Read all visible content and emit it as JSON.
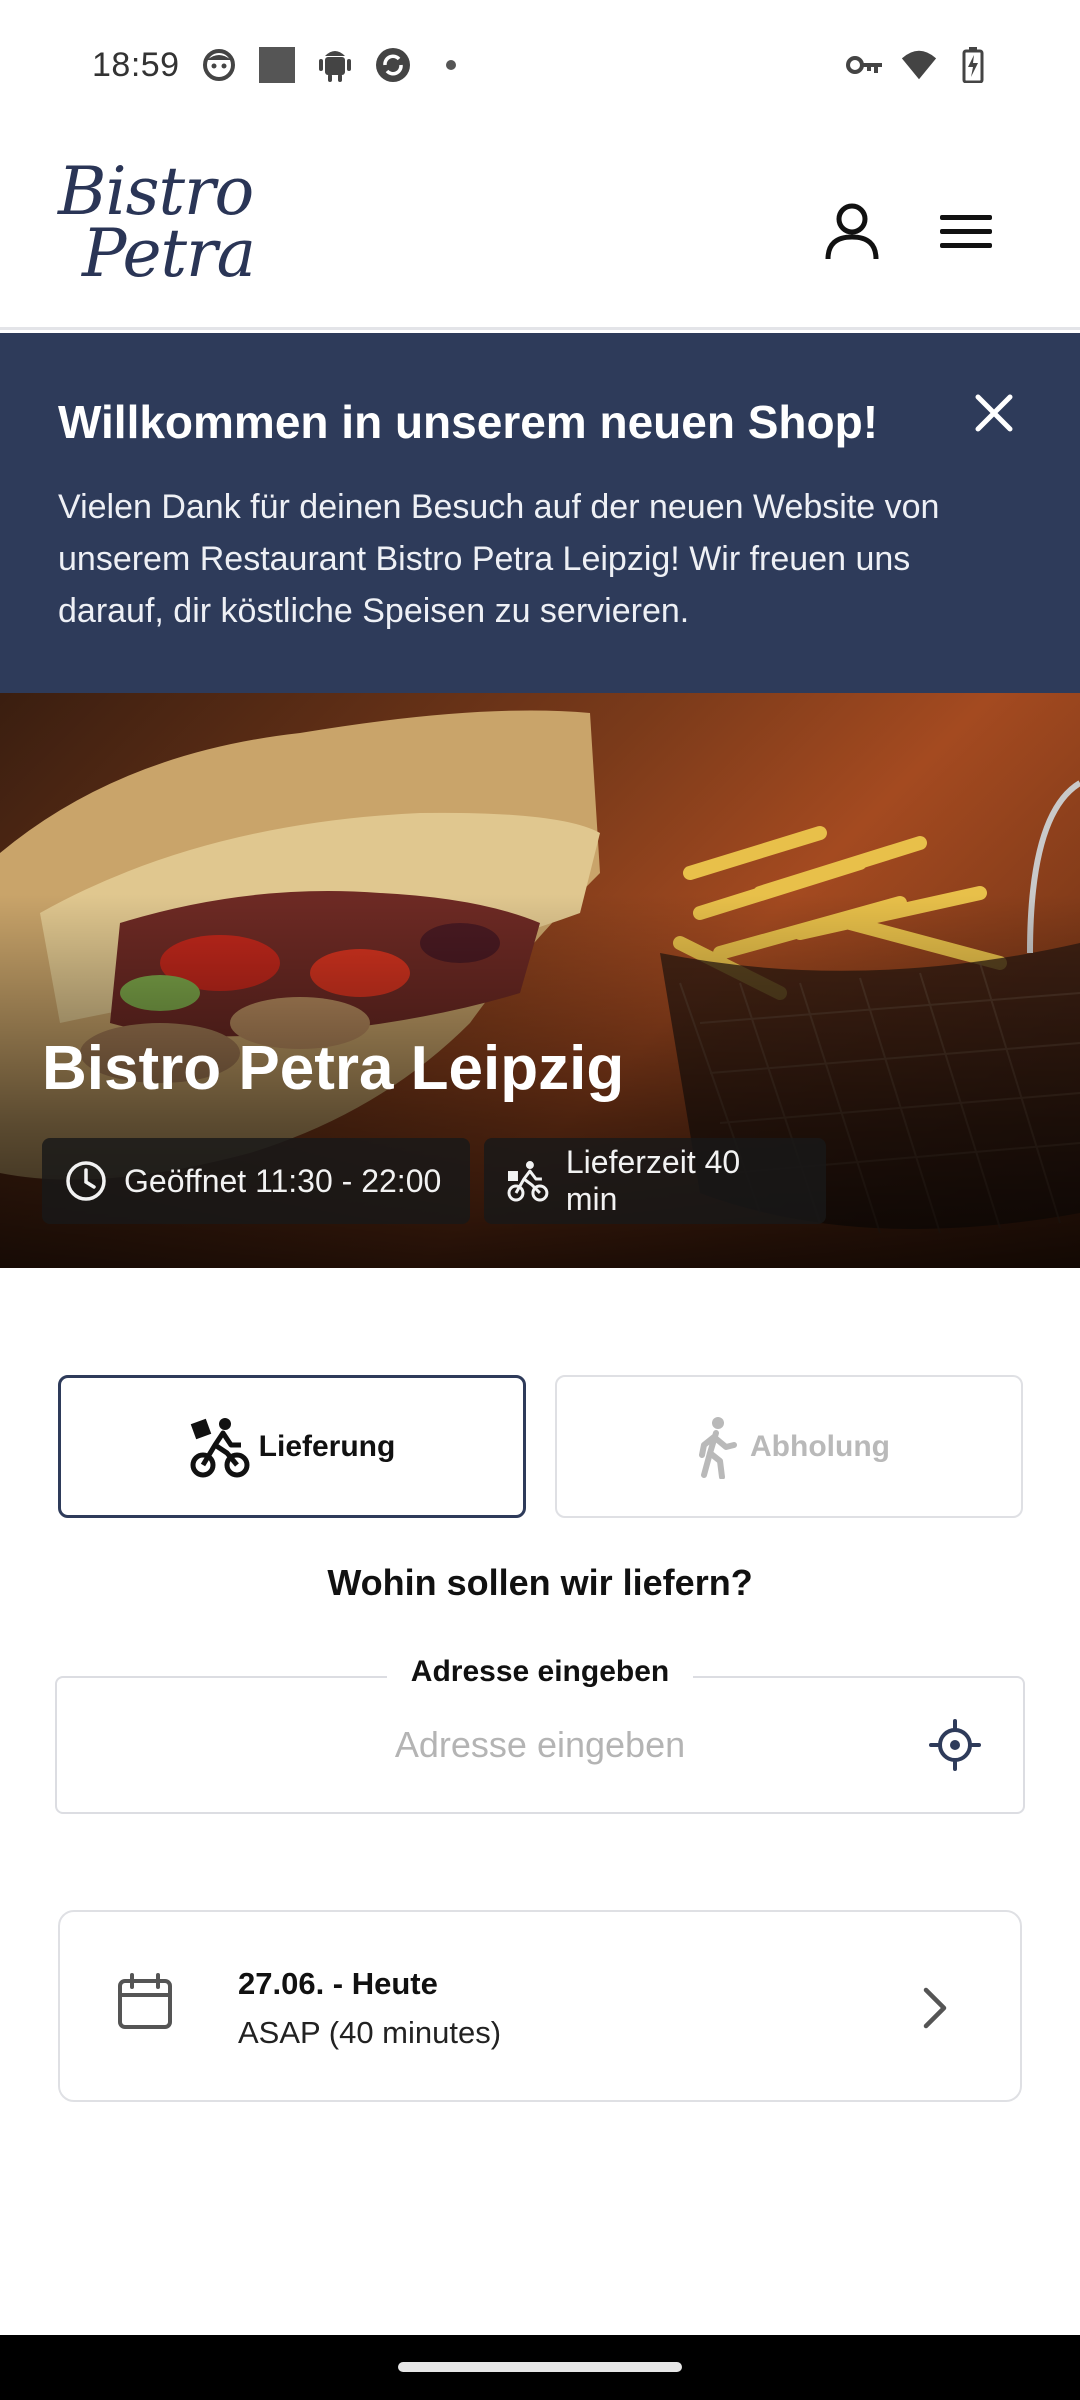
{
  "status_bar": {
    "time": "18:59",
    "left_icons": [
      "face-icon",
      "square-icon",
      "android-icon",
      "sync-icon",
      "dot-icon"
    ],
    "right_icons": [
      "key-icon",
      "wifi-icon",
      "battery-charging-icon"
    ]
  },
  "header": {
    "logo_line1": "Bistro",
    "logo_line2": "Petra",
    "account_icon": "account-icon",
    "menu_icon": "menu-icon"
  },
  "banner": {
    "title": "Willkommen in unserem neuen Shop!",
    "text": "Vielen Dank für deinen Besuch auf der neuen Website von unserem Restaurant Bistro Petra Leipzig! Wir freuen uns darauf, dir köstliche Speisen zu servieren.",
    "close_icon": "close-icon",
    "background": "#2e3b5a"
  },
  "hero": {
    "title": "Bistro Petra Leipzig",
    "opening_hours": "Geöffnet 11:30 - 22:00",
    "delivery_time": "Lieferzeit 40 min"
  },
  "mode_toggle": {
    "delivery_label": "Lieferung",
    "pickup_label": "Abholung",
    "selected": "Lieferung"
  },
  "address": {
    "question": "Wohin sollen wir liefern?",
    "legend": "Adresse eingeben",
    "placeholder": "Adresse eingeben",
    "value": ""
  },
  "schedule": {
    "date": "27.06. - Heute",
    "time": "ASAP (40 minutes)"
  },
  "colors": {
    "brand": "#2e3b5a",
    "border": "#dfe0e4",
    "muted": "#b9b9b9"
  }
}
